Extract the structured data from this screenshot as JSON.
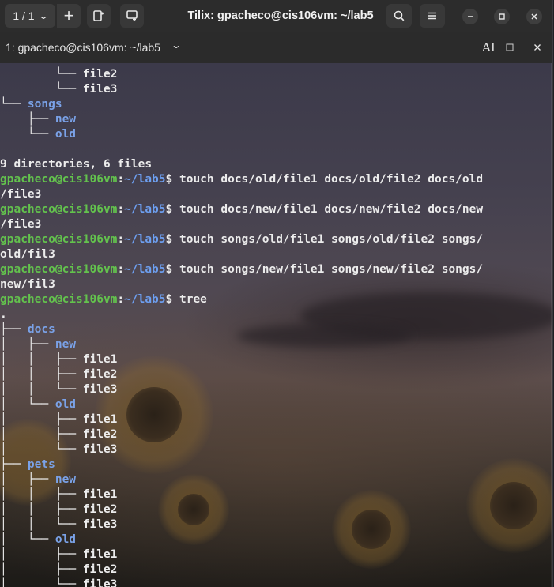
{
  "window": {
    "title": "Tilix: gpacheco@cis106vm: ~/lab5"
  },
  "header": {
    "session_counter": "1 / 1",
    "add_label": "+"
  },
  "tabbar": {
    "session_title": "1: gpacheco@cis106vm: ~/lab5"
  },
  "terminal": {
    "prompt_user": "gpacheco@cis106vm",
    "prompt_path": "~/lab5",
    "lines": [
      {
        "kind": "tree",
        "prefix": "        └── ",
        "name": "file2",
        "dir": false
      },
      {
        "kind": "tree",
        "prefix": "        └── ",
        "name": "file3",
        "dir": false
      },
      {
        "kind": "tree",
        "prefix": "└── ",
        "name": "songs",
        "dir": true
      },
      {
        "kind": "tree",
        "prefix": "    ├── ",
        "name": "new",
        "dir": true
      },
      {
        "kind": "tree",
        "prefix": "    └── ",
        "name": "old",
        "dir": true
      },
      {
        "kind": "text",
        "text": ""
      },
      {
        "kind": "text",
        "text": "9 directories, 6 files"
      },
      {
        "kind": "prompt",
        "cmd": "touch docs/old/file1 docs/old/file2 docs/old"
      },
      {
        "kind": "text",
        "text": "/file3"
      },
      {
        "kind": "prompt",
        "cmd": "touch docs/new/file1 docs/new/file2 docs/new"
      },
      {
        "kind": "text",
        "text": "/file3"
      },
      {
        "kind": "prompt",
        "cmd": "touch songs/old/file1 songs/old/file2 songs/"
      },
      {
        "kind": "text",
        "text": "old/fil3"
      },
      {
        "kind": "prompt",
        "cmd": "touch songs/new/file1 songs/new/file2 songs/"
      },
      {
        "kind": "text",
        "text": "new/fil3"
      },
      {
        "kind": "prompt",
        "cmd": "tree"
      },
      {
        "kind": "text",
        "text": "."
      },
      {
        "kind": "tree",
        "prefix": "├── ",
        "name": "docs",
        "dir": true
      },
      {
        "kind": "tree",
        "prefix": "│   ├── ",
        "name": "new",
        "dir": true
      },
      {
        "kind": "tree",
        "prefix": "│   │   ├── ",
        "name": "file1",
        "dir": false
      },
      {
        "kind": "tree",
        "prefix": "│   │   ├── ",
        "name": "file2",
        "dir": false
      },
      {
        "kind": "tree",
        "prefix": "│   │   └── ",
        "name": "file3",
        "dir": false
      },
      {
        "kind": "tree",
        "prefix": "│   └── ",
        "name": "old",
        "dir": true
      },
      {
        "kind": "tree",
        "prefix": "│       ├── ",
        "name": "file1",
        "dir": false
      },
      {
        "kind": "tree",
        "prefix": "│       ├── ",
        "name": "file2",
        "dir": false
      },
      {
        "kind": "tree",
        "prefix": "│       └── ",
        "name": "file3",
        "dir": false
      },
      {
        "kind": "tree",
        "prefix": "├── ",
        "name": "pets",
        "dir": true
      },
      {
        "kind": "tree",
        "prefix": "│   ├── ",
        "name": "new",
        "dir": true
      },
      {
        "kind": "tree",
        "prefix": "│   │   ├── ",
        "name": "file1",
        "dir": false
      },
      {
        "kind": "tree",
        "prefix": "│   │   ├── ",
        "name": "file2",
        "dir": false
      },
      {
        "kind": "tree",
        "prefix": "│   │   └── ",
        "name": "file3",
        "dir": false
      },
      {
        "kind": "tree",
        "prefix": "│   └── ",
        "name": "old",
        "dir": true
      },
      {
        "kind": "tree",
        "prefix": "│       ├── ",
        "name": "file1",
        "dir": false
      },
      {
        "kind": "tree",
        "prefix": "│       ├── ",
        "name": "file2",
        "dir": false
      },
      {
        "kind": "tree",
        "prefix": "│       └── ",
        "name": "file3",
        "dir": false
      }
    ]
  },
  "colors": {
    "prompt_user": "#63c34d",
    "prompt_path": "#6d9ff0",
    "directory": "#7aa2e8",
    "headerbar": "#2c2c2c"
  },
  "icons": {
    "session_dropdown": "chevron-down-icon",
    "add_right": "split-right-icon",
    "add_down": "split-down-icon",
    "find": "search-icon",
    "menu": "hamburger-menu-icon",
    "minimize": "minimize-icon",
    "maximize": "maximize-icon",
    "close": "close-icon",
    "readonly": "text-cursor-icon",
    "tab_maximize": "maximize-icon",
    "tab_close": "close-icon"
  }
}
